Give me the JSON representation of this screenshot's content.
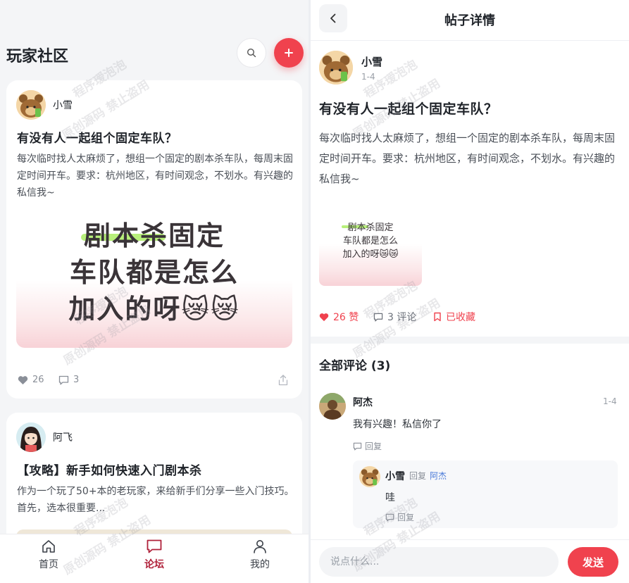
{
  "left": {
    "title": "玩家社区",
    "posts": [
      {
        "author": "小雪",
        "title": "有没有人一起组个固定车队？",
        "body": "每次临时找人太麻烦了，想组一个固定的剧本杀车队，每周末固定时间开车。要求：杭州地区，有时间观念，不划水。有兴趣的私信我~",
        "image_lines": [
          "剧本杀固定",
          "车队都是怎么",
          "加入的呀😿😿"
        ],
        "likes": "26",
        "comments": "3"
      },
      {
        "author": "阿飞",
        "title": "【攻略】新手如何快速入门剧本杀",
        "body": "作为一个玩了50+本的老玩家，来给新手们分享一些入门技巧。首先，选本很重要..."
      }
    ],
    "nav": {
      "home": "首页",
      "forum": "论坛",
      "mine": "我的"
    }
  },
  "right": {
    "header_title": "帖子详情",
    "author": "小雪",
    "date": "1-4",
    "title": "有没有人一起组个固定车队？",
    "body": "每次临时找人太麻烦了，想组一个固定的剧本杀车队，每周末固定时间开车。要求：杭州地区，有时间观念，不划水。有兴趣的私信我~",
    "image_lines": [
      "剧本杀固定",
      "车队都是怎么",
      "加入的呀😿😿"
    ],
    "likes_label": "26 赞",
    "comments_label": "3 评论",
    "favorite_label": "已收藏",
    "comments_section_title": "全部评论 (3)",
    "comments": [
      {
        "author": "阿杰",
        "date": "1-4",
        "text": "我有兴趣！私信你了",
        "reply_label": "回复"
      }
    ],
    "sub_reply": {
      "author": "小雪",
      "reply_word": "回复",
      "reply_to": "阿杰",
      "text": "哇",
      "reply_label": "回复"
    },
    "input_placeholder": "说点什么...",
    "send_label": "发送"
  },
  "watermark": {
    "line1": "程序瑷泡泡",
    "line2": "原创源码 禁止盗用"
  },
  "colors": {
    "accent": "#f0424e",
    "nav_active": "#b0213a",
    "text": "#1f2329",
    "muted": "#8a8f98"
  }
}
